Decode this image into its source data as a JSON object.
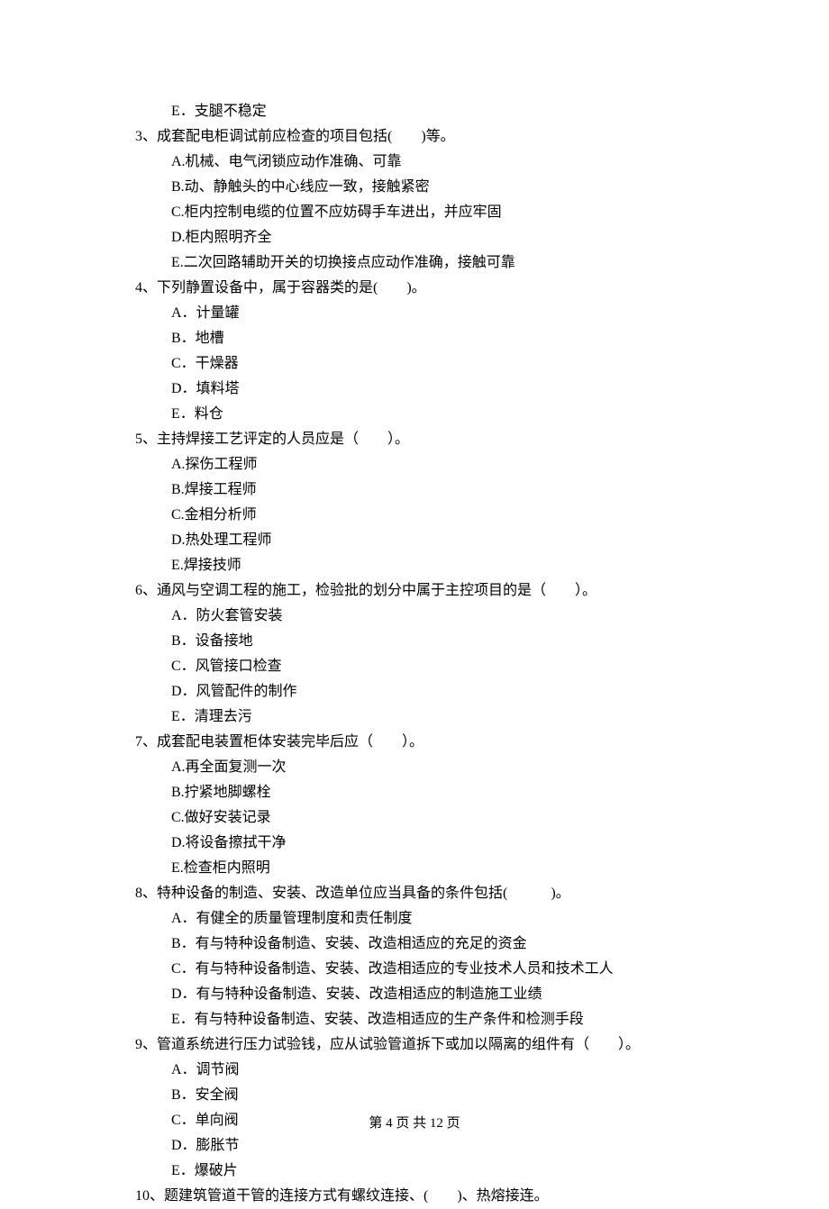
{
  "q2_optE": "E．支腿不稳定",
  "q3": {
    "text": "3、成套配电柜调试前应检查的项目包括(　　)等。",
    "A": "A.机械、电气闭锁应动作准确、可靠",
    "B": "B.动、静触头的中心线应一致，接触紧密",
    "C": "C.柜内控制电缆的位置不应妨碍手车进出，并应牢固",
    "D": "D.柜内照明齐全",
    "E": "E.二次回路辅助开关的切换接点应动作准确，接触可靠"
  },
  "q4": {
    "text": "4、下列静置设备中，属于容器类的是(　　)。",
    "A": "A．计量罐",
    "B": "B．地槽",
    "C": "C．干燥器",
    "D": "D．填料塔",
    "E": "E．料仓"
  },
  "q5": {
    "text": "5、主持焊接工艺评定的人员应是（　　）。",
    "A": "A.探伤工程师",
    "B": "B.焊接工程师",
    "C": "C.金相分析师",
    "D": "D.热处理工程师",
    "E": "E.焊接技师"
  },
  "q6": {
    "text": "6、通风与空调工程的施工，检验批的划分中属于主控项目的是（　　）。",
    "A": "A．防火套管安装",
    "B": "B．设备接地",
    "C": "C．风管接口检查",
    "D": "D．风管配件的制作",
    "E": "E．清理去污"
  },
  "q7": {
    "text": "7、成套配电装置柜体安装完毕后应（　　）。",
    "A": "A.再全面复测一次",
    "B": "B.拧紧地脚螺栓",
    "C": "C.做好安装记录",
    "D": "D.将设备擦拭干净",
    "E": "E.检查柜内照明"
  },
  "q8": {
    "text": "8、特种设备的制造、安装、改造单位应当具备的条件包括(　　　)。",
    "A": "A．有健全的质量管理制度和责任制度",
    "B": "B．有与特种设备制造、安装、改造相适应的充足的资金",
    "C": "C．有与特种设备制造、安装、改造相适应的专业技术人员和技术工人",
    "D": "D．有与特种设备制造、安装、改造相适应的制造施工业绩",
    "E": "E．有与特种设备制造、安装、改造相适应的生产条件和检测手段"
  },
  "q9": {
    "text": "9、管道系统进行压力试验钱，应从试验管道拆下或加以隔离的组件有（　　）。",
    "A": "A．调节阀",
    "B": "B．安全阀",
    "C": "C．单向阀",
    "D": "D．膨胀节",
    "E": "E．爆破片"
  },
  "q10": {
    "text": "10、题建筑管道干管的连接方式有螺纹连接、(　　)、热熔接连。"
  },
  "footer": "第 4 页 共 12 页"
}
